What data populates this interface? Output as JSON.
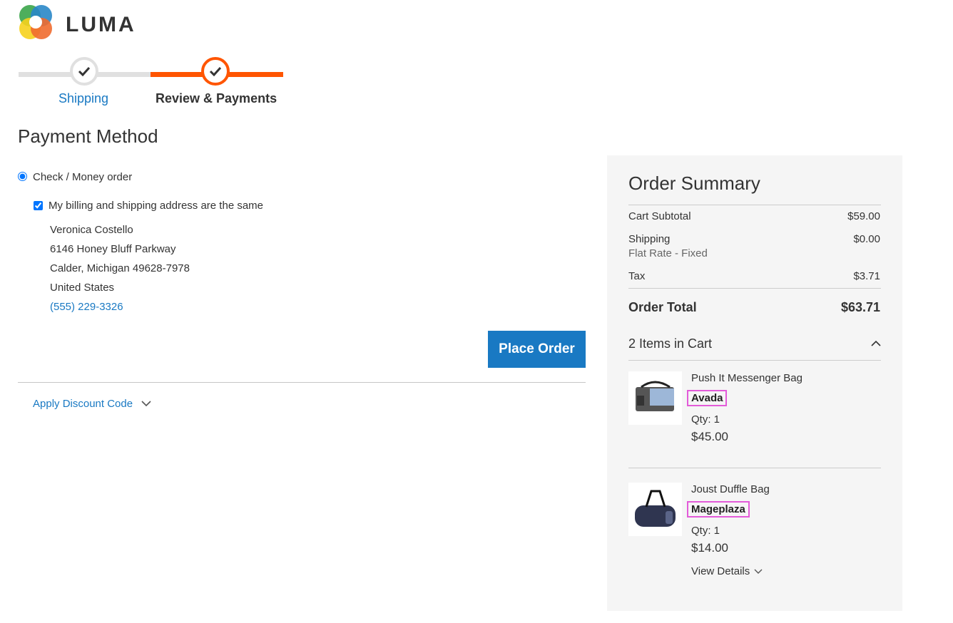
{
  "brand": {
    "name": "LUMA"
  },
  "progress": {
    "steps": [
      {
        "label": "Shipping",
        "state": "done"
      },
      {
        "label": "Review & Payments",
        "state": "active"
      }
    ],
    "colors": {
      "active": "#ff5501",
      "done": "#e0e0e0",
      "link": "#1979c3"
    }
  },
  "payment": {
    "title": "Payment Method",
    "method_label": "Check / Money order",
    "same_address_label": "My billing and shipping address are the same",
    "address": {
      "name": "Veronica Costello",
      "street": "6146 Honey Bluff Parkway",
      "city_line": "Calder, Michigan 49628-7978",
      "country": "United States",
      "phone": "(555) 229-3326"
    },
    "place_order_label": "Place Order",
    "discount_label": "Apply Discount Code"
  },
  "summary": {
    "title": "Order Summary",
    "subtotal_label": "Cart Subtotal",
    "subtotal_value": "$59.00",
    "shipping_label": "Shipping",
    "shipping_method": "Flat Rate - Fixed",
    "shipping_value": "$0.00",
    "tax_label": "Tax",
    "tax_value": "$3.71",
    "total_label": "Order Total",
    "total_value": "$63.71",
    "items_heading": "2 Items in Cart",
    "items": [
      {
        "name": "Push It Messenger Bag",
        "brand": "Avada",
        "qty": "Qty: 1",
        "price": "$45.00"
      },
      {
        "name": "Joust Duffle Bag",
        "brand": "Mageplaza",
        "qty": "Qty: 1",
        "price": "$14.00"
      }
    ],
    "view_details_label": "View Details"
  }
}
